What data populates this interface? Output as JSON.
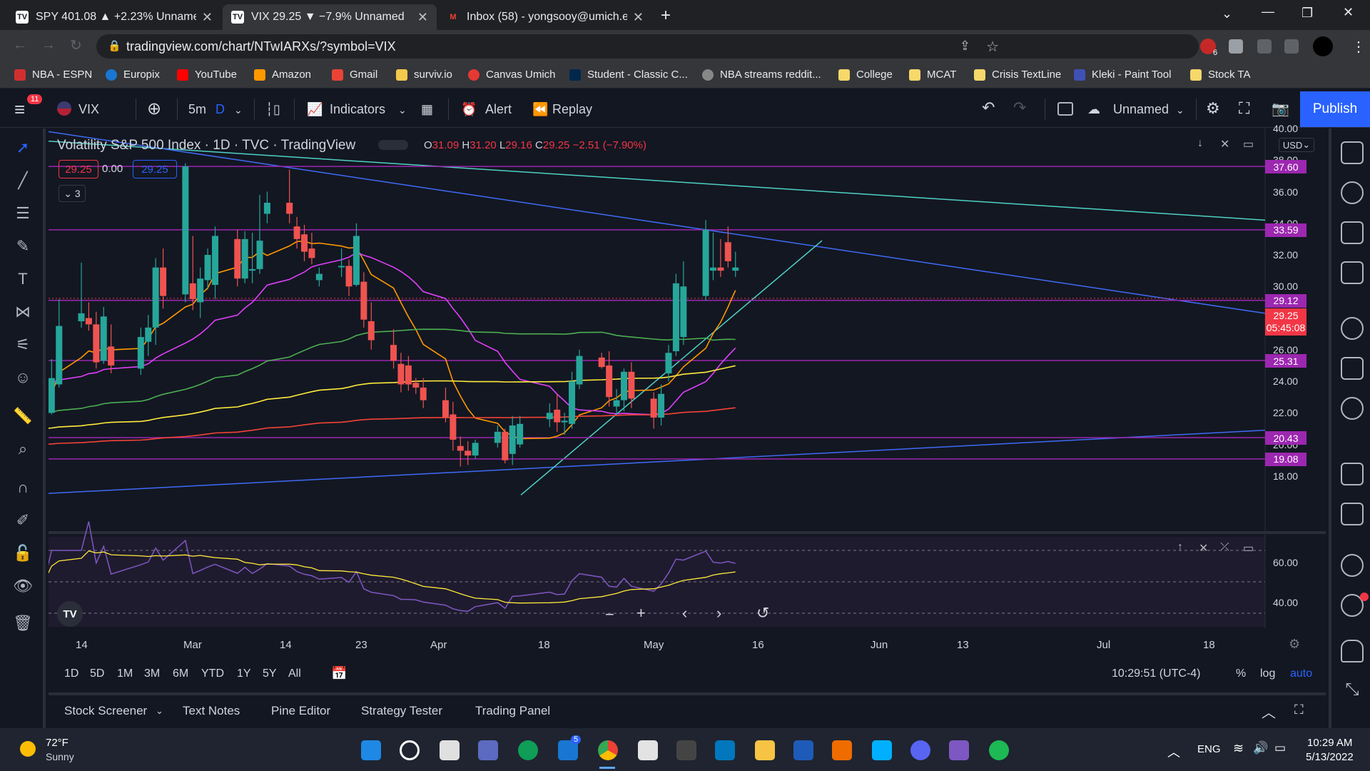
{
  "browser": {
    "tabs": [
      {
        "title": "SPY 401.08 ▲ +2.23% Unnamed",
        "active": false
      },
      {
        "title": "VIX 29.25 ▼ −7.9% Unnamed",
        "active": true
      },
      {
        "title": "Inbox (58) - yongsooy@umich.ed",
        "active": false
      }
    ],
    "url": "tradingview.com/chart/NTwIARXs/?symbol=VIX",
    "ext_badge": "6",
    "bookmarks": [
      "NBA - ESPN",
      "Europix",
      "YouTube",
      "Amazon",
      "Gmail",
      "surviv.io",
      "Canvas Umich",
      "Student - Classic C...",
      "NBA streams reddit...",
      "College",
      "MCAT",
      "Crisis TextLine",
      "Kleki - Paint Tool",
      "Stock TA"
    ]
  },
  "toolbar": {
    "notif_badge": "11",
    "symbol": "VIX",
    "interval": "5m",
    "interval_d": "D",
    "indicators": "Indicators",
    "alert": "Alert",
    "replay": "Replay",
    "layout_name": "Unnamed",
    "publish": "Publish"
  },
  "legend": {
    "title": "Volatility S&P 500 Index · 1D · TVC · TradingView",
    "o_label": "O",
    "o": "31.09",
    "h_label": "H",
    "h": "31.20",
    "l_label": "L",
    "l": "29.16",
    "c_label": "C",
    "c": "29.25",
    "change": "−2.51 (−7.90%)",
    "bid": "29.25",
    "spread": "0.00",
    "ask": "29.25",
    "collapse_count": "3",
    "currency": "USD"
  },
  "price_axis": {
    "ticks": [
      "40.00",
      "38.00",
      "36.00",
      "34.00",
      "32.00",
      "30.00",
      "26.00",
      "24.00",
      "22.00",
      "20.00",
      "18.00"
    ],
    "levels": [
      {
        "value": "37.60",
        "color": "#9c27b0"
      },
      {
        "value": "33.59",
        "color": "#9c27b0"
      },
      {
        "value": "29.12",
        "color": "#9c27b0"
      },
      {
        "value": "25.31",
        "color": "#9c27b0"
      },
      {
        "value": "20.43",
        "color": "#9c27b0"
      },
      {
        "value": "19.08",
        "color": "#9c27b0"
      }
    ],
    "last_price": "29.25",
    "countdown": "05:45:08"
  },
  "rsi_axis": {
    "ticks": [
      "60.00",
      "40.00"
    ]
  },
  "time_axis": {
    "labels": [
      "14",
      "Mar",
      "14",
      "23",
      "Apr",
      "18",
      "May",
      "16",
      "Jun",
      "13",
      "Jul",
      "18"
    ]
  },
  "timeframes": [
    "1D",
    "5D",
    "1M",
    "3M",
    "6M",
    "YTD",
    "1Y",
    "5Y",
    "All"
  ],
  "clock": "10:29:51 (UTC-4)",
  "scale_opts": [
    "%",
    "log",
    "auto"
  ],
  "bottom_tabs": [
    "Stock Screener",
    "Text Notes",
    "Pine Editor",
    "Strategy Tester",
    "Trading Panel"
  ],
  "taskbar": {
    "weather_temp": "72°F",
    "weather_desc": "Sunny",
    "lang": "ENG",
    "time": "10:29 AM",
    "date": "5/13/2022",
    "mail_badge": "5"
  },
  "colors": {
    "up": "#26a69a",
    "down": "#ef5350",
    "bg": "#131722",
    "accent": "#2962ff",
    "level": "#9c27b0"
  },
  "chart_data": {
    "type": "candlestick",
    "title": "Volatility S&P 500 Index · 1D · TVC · TradingView",
    "ylim": [
      16.5,
      40
    ],
    "x_range": [
      "Feb 10",
      "Jul 26"
    ],
    "levels": [
      37.6,
      33.59,
      29.12,
      25.31,
      20.43,
      19.08
    ],
    "candles": [
      {
        "date": "2022-02-09",
        "o": 20.4,
        "h": 22.3,
        "l": 20.1,
        "c": 22.0
      },
      {
        "date": "2022-02-10",
        "o": 22.0,
        "h": 25.4,
        "l": 21.9,
        "c": 24.2
      },
      {
        "date": "2022-02-11",
        "o": 23.8,
        "h": 29.2,
        "l": 23.6,
        "c": 27.5
      },
      {
        "date": "2022-02-14",
        "o": 27.8,
        "h": 31.5,
        "l": 27.4,
        "c": 28.3
      },
      {
        "date": "2022-02-15",
        "o": 28.0,
        "h": 29.0,
        "l": 27.2,
        "c": 27.6
      },
      {
        "date": "2022-02-16",
        "o": 27.6,
        "h": 28.4,
        "l": 24.8,
        "c": 25.2
      },
      {
        "date": "2022-02-17",
        "o": 25.3,
        "h": 28.7,
        "l": 25.1,
        "c": 28.1
      },
      {
        "date": "2022-02-18",
        "o": 26.2,
        "h": 27.6,
        "l": 24.5,
        "c": 25.0
      },
      {
        "date": "2022-02-22",
        "o": 24.8,
        "h": 27.4,
        "l": 24.4,
        "c": 26.8
      },
      {
        "date": "2022-02-23",
        "o": 26.5,
        "h": 28.2,
        "l": 25.6,
        "c": 27.4
      },
      {
        "date": "2022-02-24",
        "o": 27.4,
        "h": 31.8,
        "l": 26.3,
        "c": 31.2
      },
      {
        "date": "2022-02-25",
        "o": 31.2,
        "h": 32.4,
        "l": 28.6,
        "c": 29.4
      },
      {
        "date": "2022-02-28",
        "o": 29.5,
        "h": 37.8,
        "l": 29.0,
        "c": 37.6
      },
      {
        "date": "2022-03-01",
        "o": 30.2,
        "h": 33.2,
        "l": 28.5,
        "c": 29.2
      },
      {
        "date": "2022-03-02",
        "o": 29.0,
        "h": 31.2,
        "l": 28.0,
        "c": 30.5
      },
      {
        "date": "2022-03-03",
        "o": 30.4,
        "h": 32.4,
        "l": 29.8,
        "c": 32.0
      },
      {
        "date": "2022-03-04",
        "o": 30.1,
        "h": 33.8,
        "l": 29.2,
        "c": 33.2
      },
      {
        "date": "2022-03-07",
        "o": 33.0,
        "h": 33.6,
        "l": 30.0,
        "c": 30.5
      },
      {
        "date": "2022-03-08",
        "o": 30.5,
        "h": 33.5,
        "l": 30.2,
        "c": 33.0
      },
      {
        "date": "2022-03-09",
        "o": 31.0,
        "h": 33.4,
        "l": 30.2,
        "c": 31.1
      },
      {
        "date": "2022-03-10",
        "o": 31.1,
        "h": 35.8,
        "l": 30.8,
        "c": 32.9
      },
      {
        "date": "2022-03-11",
        "o": 34.6,
        "h": 36.0,
        "l": 34.0,
        "c": 35.3
      },
      {
        "date": "2022-03-14",
        "o": 35.3,
        "h": 37.4,
        "l": 34.0,
        "c": 34.6
      },
      {
        "date": "2022-03-15",
        "o": 33.8,
        "h": 34.4,
        "l": 32.4,
        "c": 33.0
      },
      {
        "date": "2022-03-16",
        "o": 33.3,
        "h": 33.9,
        "l": 31.6,
        "c": 32.2
      },
      {
        "date": "2022-03-17",
        "o": 32.4,
        "h": 33.4,
        "l": 31.4,
        "c": 31.8
      },
      {
        "date": "2022-03-18",
        "o": 30.4,
        "h": 31.2,
        "l": 30.0,
        "c": 30.8
      },
      {
        "date": "2022-03-21",
        "o": 31.3,
        "h": 32.4,
        "l": 30.6,
        "c": 31.3
      },
      {
        "date": "2022-03-22",
        "o": 31.3,
        "h": 31.7,
        "l": 29.4,
        "c": 30.0
      },
      {
        "date": "2022-03-23",
        "o": 30.1,
        "h": 34.0,
        "l": 30.0,
        "c": 33.2
      },
      {
        "date": "2022-03-24",
        "o": 30.3,
        "h": 30.9,
        "l": 27.4,
        "c": 27.9
      },
      {
        "date": "2022-03-25",
        "o": 27.8,
        "h": 29.0,
        "l": 26.0,
        "c": 26.6
      },
      {
        "date": "2022-03-28",
        "o": 26.3,
        "h": 27.3,
        "l": 24.8,
        "c": 25.3
      },
      {
        "date": "2022-03-29",
        "o": 25.1,
        "h": 25.8,
        "l": 23.3,
        "c": 23.8
      },
      {
        "date": "2022-03-30",
        "o": 25.0,
        "h": 25.6,
        "l": 23.4,
        "c": 23.8
      },
      {
        "date": "2022-03-31",
        "o": 23.9,
        "h": 24.2,
        "l": 23.2,
        "c": 23.6
      },
      {
        "date": "2022-04-01",
        "o": 23.6,
        "h": 24.2,
        "l": 22.3,
        "c": 22.8
      },
      {
        "date": "2022-04-04",
        "o": 22.8,
        "h": 23.6,
        "l": 21.4,
        "c": 21.7
      },
      {
        "date": "2022-04-05",
        "o": 21.9,
        "h": 22.7,
        "l": 19.6,
        "c": 20.3
      },
      {
        "date": "2022-04-06",
        "o": 19.9,
        "h": 20.5,
        "l": 18.6,
        "c": 19.6
      },
      {
        "date": "2022-04-07",
        "o": 19.6,
        "h": 20.2,
        "l": 18.7,
        "c": 19.3
      },
      {
        "date": "2022-04-08",
        "o": 19.3,
        "h": 20.3,
        "l": 19.1,
        "c": 20.1
      },
      {
        "date": "2022-04-11",
        "o": 20.1,
        "h": 21.2,
        "l": 19.8,
        "c": 20.8
      },
      {
        "date": "2022-04-12",
        "o": 20.8,
        "h": 21.0,
        "l": 18.8,
        "c": 19.0
      },
      {
        "date": "2022-04-13",
        "o": 19.4,
        "h": 21.8,
        "l": 18.7,
        "c": 21.2
      },
      {
        "date": "2022-04-14",
        "o": 20.0,
        "h": 21.8,
        "l": 19.8,
        "c": 21.3
      },
      {
        "date": "2022-04-18",
        "o": 21.6,
        "h": 22.6,
        "l": 21.1,
        "c": 22.0
      },
      {
        "date": "2022-04-19",
        "o": 22.2,
        "h": 23.2,
        "l": 20.8,
        "c": 21.4
      },
      {
        "date": "2022-04-20",
        "o": 21.4,
        "h": 22.0,
        "l": 20.6,
        "c": 21.5
      },
      {
        "date": "2022-04-21",
        "o": 21.3,
        "h": 24.6,
        "l": 21.0,
        "c": 24.0
      },
      {
        "date": "2022-04-22",
        "o": 23.8,
        "h": 26.0,
        "l": 23.5,
        "c": 25.6
      },
      {
        "date": "2022-04-25",
        "o": 25.5,
        "h": 25.8,
        "l": 24.8,
        "c": 24.9
      },
      {
        "date": "2022-04-26",
        "o": 25.0,
        "h": 25.9,
        "l": 22.4,
        "c": 23.0
      },
      {
        "date": "2022-04-27",
        "o": 22.4,
        "h": 23.5,
        "l": 21.9,
        "c": 22.8
      },
      {
        "date": "2022-04-28",
        "o": 22.8,
        "h": 24.8,
        "l": 22.1,
        "c": 24.6
      },
      {
        "date": "2022-04-29",
        "o": 24.6,
        "h": 25.2,
        "l": 22.3,
        "c": 22.9
      },
      {
        "date": "2022-05-02",
        "o": 22.9,
        "h": 23.3,
        "l": 21.0,
        "c": 21.7
      },
      {
        "date": "2022-05-03",
        "o": 21.7,
        "h": 23.8,
        "l": 21.2,
        "c": 23.2
      },
      {
        "date": "2022-05-04",
        "o": 24.5,
        "h": 26.3,
        "l": 24.0,
        "c": 25.8
      },
      {
        "date": "2022-05-05",
        "o": 25.9,
        "h": 30.8,
        "l": 25.6,
        "c": 30.2
      },
      {
        "date": "2022-05-06",
        "o": 26.8,
        "h": 31.6,
        "l": 26.3,
        "c": 30.0
      },
      {
        "date": "2022-05-09",
        "o": 29.4,
        "h": 34.2,
        "l": 29.1,
        "c": 33.6
      },
      {
        "date": "2022-05-10",
        "o": 31.0,
        "h": 33.4,
        "l": 30.4,
        "c": 31.2
      },
      {
        "date": "2022-05-11",
        "o": 31.2,
        "h": 33.0,
        "l": 30.6,
        "c": 31.0
      },
      {
        "date": "2022-05-12",
        "o": 32.8,
        "h": 33.8,
        "l": 31.2,
        "c": 31.6
      },
      {
        "date": "2022-05-13",
        "o": 31.0,
        "h": 32.2,
        "l": 30.6,
        "c": 31.2
      }
    ]
  }
}
